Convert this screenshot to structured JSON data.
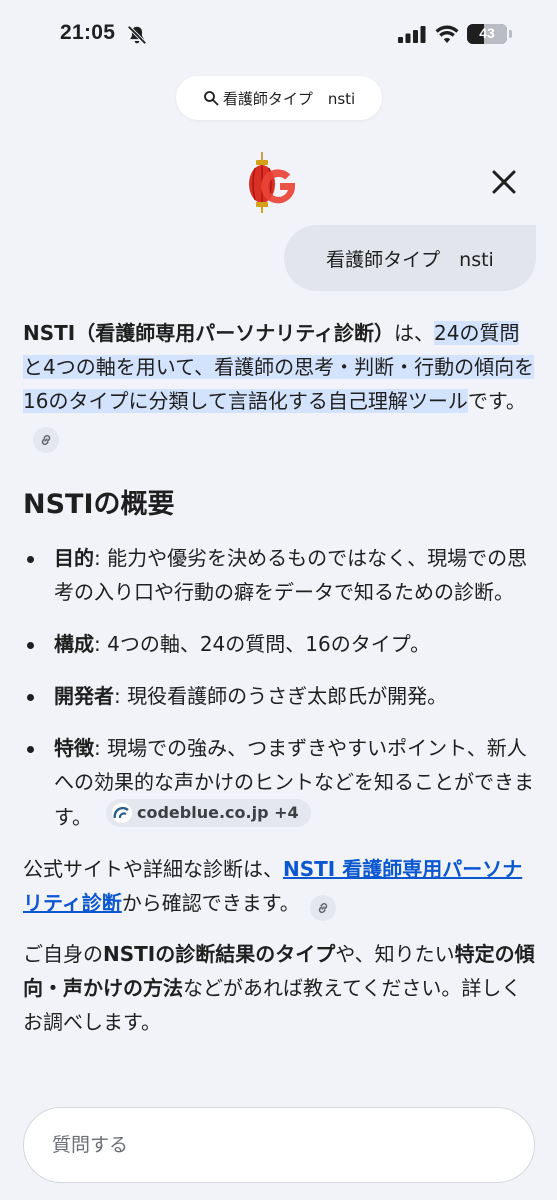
{
  "status": {
    "time": "21:05",
    "battery": "43",
    "battery_level": 0.43
  },
  "search_pill": {
    "query": "看護師タイプ　nsti"
  },
  "query_bubble": {
    "text": "看護師タイプ　nsti"
  },
  "answer": {
    "intro_bold": "NSTI（看護師専用パーソナリティ診断）",
    "intro_mid": "は、",
    "intro_hl": "24の質問と4つの軸を用いて、看護師の思考・判断・行動の傾向を16のタイプに分類して言語化する自己理解ツール",
    "intro_end": "です。",
    "section_title": "NSTIの概要",
    "bullets": [
      {
        "label": "目的",
        "text": ": 能力や優劣を決めるものではなく、現場での思考の入り口や行動の癖をデータで知るための診断。"
      },
      {
        "label": "構成",
        "text": ": 4つの軸、24の質問、16のタイプ。"
      },
      {
        "label": "開発者",
        "text": ": 現役看護師のうさぎ太郎氏が開発。"
      },
      {
        "label": "特徴",
        "text": ": 現場での強み、つまずきやすいポイント、新人への効果的な声かけのヒントなどを知ることができます。"
      }
    ],
    "source_chip": "codeblue.co.jp +4",
    "p2_pre": "公式サイトや詳細な診断は、",
    "p2_link": "NSTI 看護師専用パーソナリティ診断",
    "p2_post": "から確認できます。",
    "p3_a": "ご自身の",
    "p3_b1": "NSTIの診断結果のタイプ",
    "p3_c": "や、知りたい",
    "p3_b2": "特定の傾向・声かけの方法",
    "p3_d": "などがあれば教えてください。詳しくお調べします。"
  },
  "ask_bar": {
    "placeholder": "質問する"
  },
  "colors": {
    "accent_link": "#0b57d0",
    "highlight": "#d3e3fd",
    "background": "#f1f3f8"
  },
  "icons": [
    "bell-slash-icon",
    "signal-icon",
    "wifi-icon",
    "battery-icon",
    "search-icon",
    "google-lantern-logo",
    "close-icon",
    "link-icon",
    "codeblue-favicon-icon"
  ]
}
